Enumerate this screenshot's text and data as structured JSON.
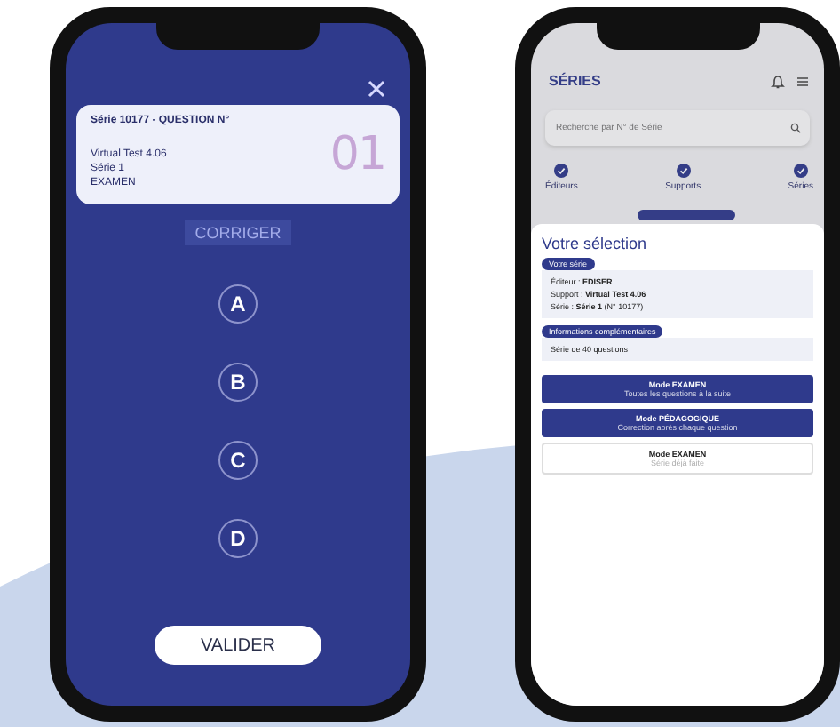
{
  "quiz": {
    "question_card": {
      "title": "Série 10177 - QUESTION N°",
      "lines": [
        "Virtual Test 4.06",
        "Série 1",
        "EXAMEN"
      ],
      "number": "01"
    },
    "correct_button": {
      "label": "CORRIGER",
      "disabled": true
    },
    "answers": [
      {
        "label": "A",
        "selected": false
      },
      {
        "label": "B",
        "selected": false
      },
      {
        "label": "C",
        "selected": false
      },
      {
        "label": "D",
        "selected": false
      }
    ],
    "submit_button": {
      "label": "VALIDER"
    }
  },
  "series_app": {
    "title": "SÉRIES",
    "search": {
      "placeholder": "Recherche par N° de Série"
    },
    "nav": [
      {
        "label": "Éditeurs"
      },
      {
        "label": "Supports"
      },
      {
        "label": "Séries"
      }
    ],
    "selection_sheet": {
      "title": "Votre sélection",
      "sections": [
        {
          "badge": "Votre série",
          "lines": [
            "Éditeur : **EDISER**",
            "Support : **Virtual Test 4.06**",
            "Série : **Série 1** (N° 10177)"
          ]
        },
        {
          "badge": "Informations complémentaires",
          "lines": [
            "Série de 40 questions"
          ]
        }
      ],
      "modes": [
        {
          "kind": "primary",
          "title": "Mode EXAMEN",
          "subtitle": "Toutes les questions à la suite"
        },
        {
          "kind": "primary",
          "title": "Mode PÉDAGOGIQUE",
          "subtitle": "Correction après chaque question"
        },
        {
          "kind": "outline",
          "title": "Mode EXAMEN",
          "subtitle": "Série déjà faite"
        }
      ]
    }
  }
}
